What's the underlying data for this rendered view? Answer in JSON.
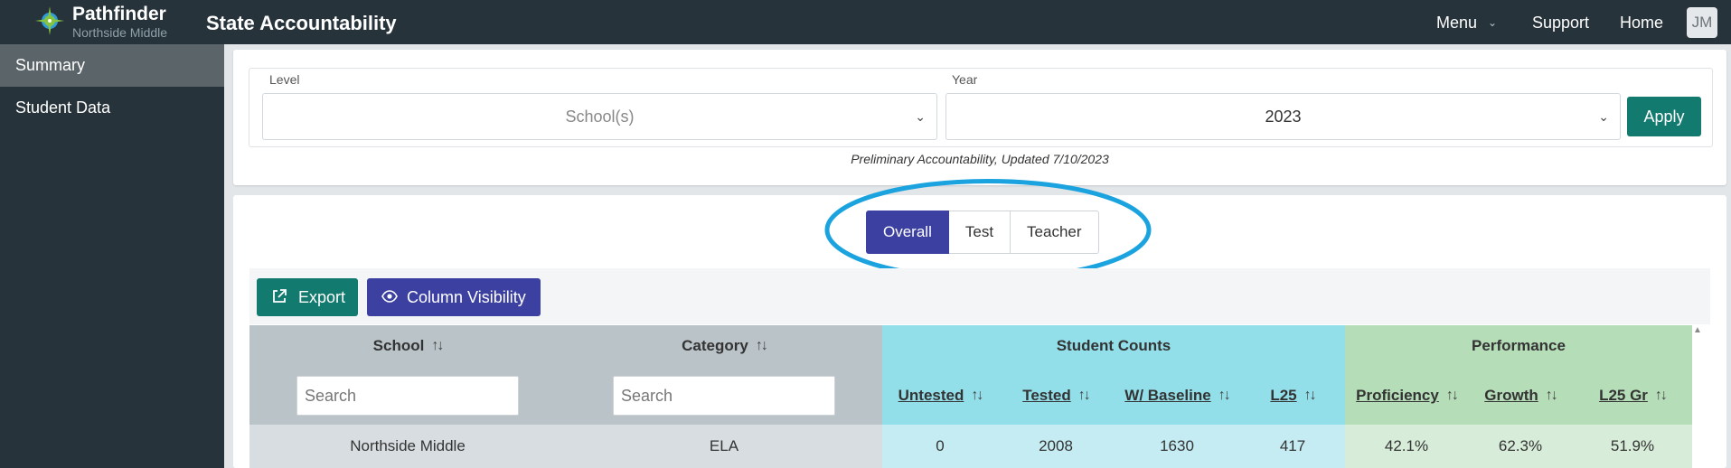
{
  "topbar": {
    "brand_name": "Pathfinder",
    "brand_sub": "Northside Middle",
    "app_title": "State Accountability",
    "menu_label": "Menu",
    "support_label": "Support",
    "home_label": "Home",
    "avatar_initials": "JM"
  },
  "sidebar": {
    "items": [
      {
        "label": "Summary",
        "active": true
      },
      {
        "label": "Student Data",
        "active": false
      }
    ]
  },
  "filters": {
    "level_label": "Level",
    "level_placeholder": "School(s)",
    "year_label": "Year",
    "year_value": "2023",
    "apply_label": "Apply",
    "note": "Preliminary Accountability, Updated 7/10/2023"
  },
  "tabs": [
    {
      "label": "Overall",
      "active": true
    },
    {
      "label": "Test",
      "active": false
    },
    {
      "label": "Teacher",
      "active": false
    }
  ],
  "toolbar": {
    "export_label": "Export",
    "column_visibility_label": "Column Visibility"
  },
  "table": {
    "group_headers": {
      "school": "School",
      "category": "Category",
      "student_counts": "Student Counts",
      "performance": "Performance"
    },
    "search_placeholder": "Search",
    "columns": [
      "Untested",
      "Tested",
      "W/ Baseline",
      "L25",
      "Proficiency",
      "Growth",
      "L25 Gr"
    ],
    "rows": [
      {
        "school": "Northside Middle",
        "category": "ELA",
        "untested": "0",
        "tested": "2008",
        "baseline": "1630",
        "l25": "417",
        "proficiency": "42.1%",
        "growth": "62.3%",
        "l25gr": "51.9%"
      }
    ]
  },
  "colors": {
    "topbar": "#27333a",
    "accent_teal": "#127a6e",
    "accent_indigo": "#3c40a1",
    "header_blue": "#92dfea",
    "header_green": "#b5ddb8",
    "highlight_ellipse": "#1aa3df"
  }
}
